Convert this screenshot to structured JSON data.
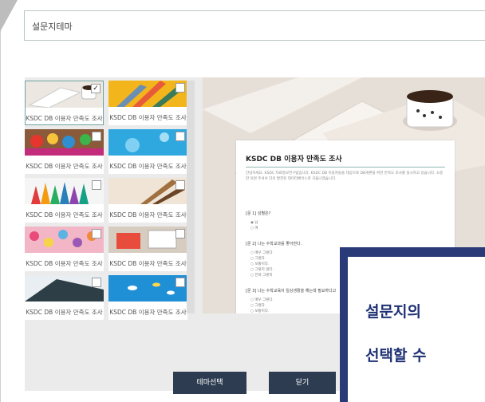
{
  "window": {
    "title": "설문지테마"
  },
  "themes": [
    {
      "caption": "KSDC DB 이용자 만족도 조사",
      "selected": true,
      "theme": "coffee-book"
    },
    {
      "caption": "KSDC DB 이용자 만족도 조사",
      "selected": false,
      "theme": "yellow-pencils"
    },
    {
      "caption": "KSDC DB 이용자 만족도 조사",
      "selected": false,
      "theme": "paint-brushes"
    },
    {
      "caption": "KSDC DB 이용자 만족도 조사",
      "selected": false,
      "theme": "blue-sky"
    },
    {
      "caption": "KSDC DB 이용자 만족도 조사",
      "selected": false,
      "theme": "colored-pencils"
    },
    {
      "caption": "KSDC DB 이용자 만족도 조사",
      "selected": false,
      "theme": "brown-pencils"
    },
    {
      "caption": "KSDC DB 이용자 만족도 조사",
      "selected": false,
      "theme": "flowers"
    },
    {
      "caption": "KSDC DB 이용자 만족도 조사",
      "selected": false,
      "theme": "desk-stationery"
    },
    {
      "caption": "KSDC DB 이용자 만족도 조사",
      "selected": false,
      "theme": "dark-laptop"
    },
    {
      "caption": "KSDC DB 이용자 만족도 조사",
      "selected": false,
      "theme": "fish-sea"
    }
  ],
  "preview": {
    "title": "KSDC DB 이용자 만족도 조사",
    "description": "안녕하세요. KSDC 자료정보연구팀입니다. KSDC DB 이용자들을 대상으로 DB개편을 위한 만족도 조사를 실시하고 있습니다. 소중한 의견 주셔서 더욱 발전된 데이터베이스로 거듭나겠습니다.",
    "questions": [
      {
        "label": "[문 1] 성별은?",
        "options": [
          "남",
          "여"
        ]
      },
      {
        "label": "[문 2] 나는 수학교과를 좋아한다.",
        "options": [
          "매우 그렇다.",
          "그렇다.",
          "보통이다.",
          "그렇지 않다.",
          "전혀 그렇지"
        ]
      },
      {
        "label": "[문 3] 나는 수학교육이 일상생활을 해는데 필요하다고",
        "options": [
          "매우 그렇다.",
          "그렇다.",
          "보통이다."
        ]
      }
    ]
  },
  "buttons": {
    "select_theme": "테마선택",
    "close": "닫기"
  },
  "callout": {
    "line1": "설문지의",
    "line2": "선택할 수"
  },
  "colors": {
    "accent": "#2d3c50",
    "callout_border": "#2a3a78",
    "selected_border": "#6fa2a0"
  }
}
